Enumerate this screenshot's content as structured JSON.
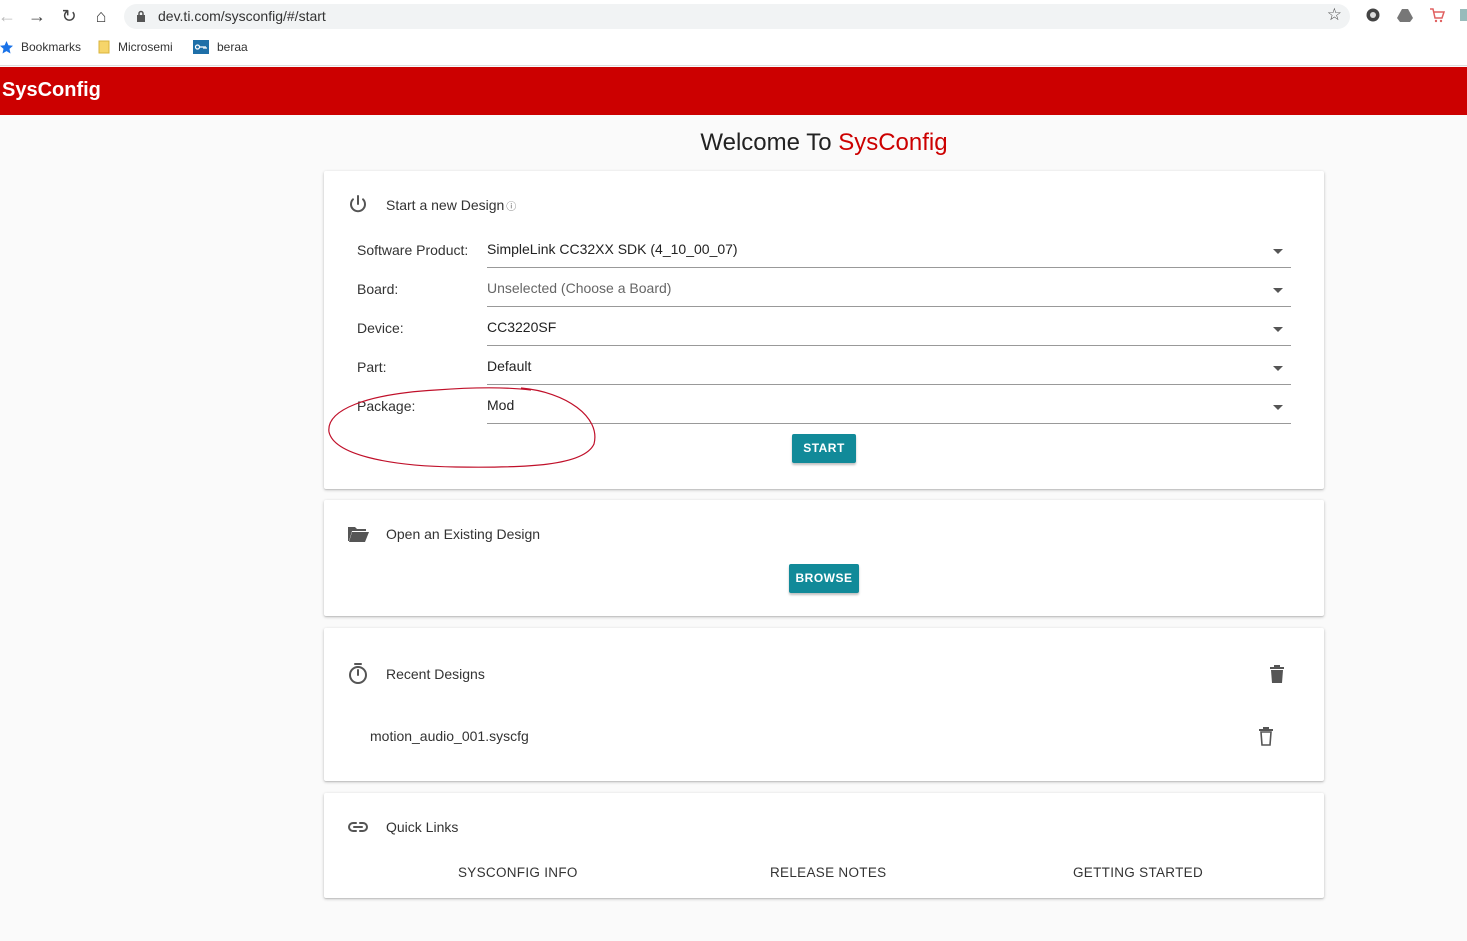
{
  "browser": {
    "url": "dev.ti.com/sysconfig/#/start",
    "bookmarks": [
      {
        "label": "Bookmarks",
        "icon": "star-icon"
      },
      {
        "label": "Microsemi",
        "icon": "folder-icon"
      },
      {
        "label": "beraa",
        "icon": "key-icon"
      }
    ]
  },
  "header": {
    "title": "SysConfig",
    "color": "#cc0000"
  },
  "welcome": {
    "prefix": "Welcome To ",
    "brand": "SysConfig"
  },
  "new_design": {
    "title": "Start a new Design",
    "help": "?",
    "fields": [
      {
        "label": "Software Product:",
        "value": "SimpleLink CC32XX SDK (4_10_00_07)",
        "placeholder": false
      },
      {
        "label": "Board:",
        "value": "Unselected (Choose a Board)",
        "placeholder": true
      },
      {
        "label": "Device:",
        "value": "CC3220SF",
        "placeholder": false
      },
      {
        "label": "Part:",
        "value": "Default",
        "placeholder": false
      },
      {
        "label": "Package:",
        "value": "Mod",
        "placeholder": false
      }
    ],
    "start_label": "START"
  },
  "open_design": {
    "title": "Open an Existing Design",
    "browse_label": "BROWSE"
  },
  "recent": {
    "title": "Recent Designs",
    "items": [
      "motion_audio_001.syscfg"
    ]
  },
  "quick_links": {
    "title": "Quick Links",
    "links": [
      "SYSCONFIG INFO",
      "RELEASE NOTES",
      "GETTING STARTED"
    ]
  },
  "accent_color": "#118a99"
}
